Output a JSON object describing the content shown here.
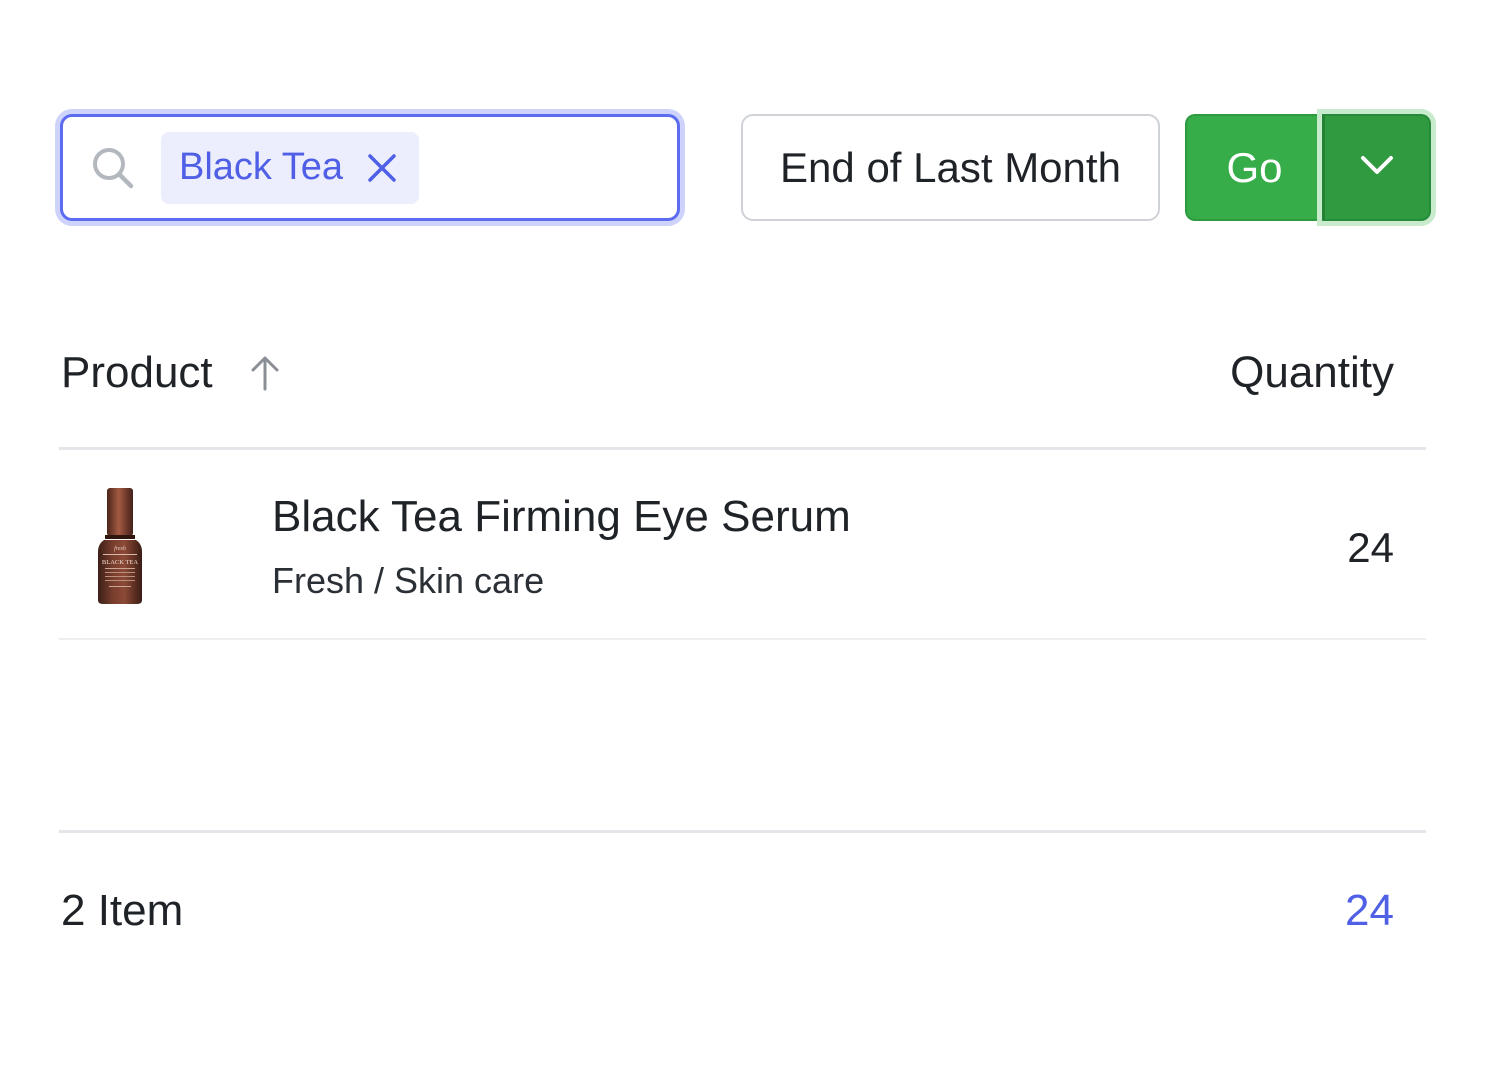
{
  "filter": {
    "chip_label": "Black Tea",
    "date_range": "End of Last Month",
    "go_label": "Go"
  },
  "table": {
    "columns": {
      "product": "Product",
      "quantity": "Quantity"
    },
    "sort": {
      "column": "product",
      "direction": "ascending"
    },
    "rows": [
      {
        "name": "Black Tea Firming Eye Serum",
        "category": "Fresh / Skin care",
        "quantity": "24"
      }
    ]
  },
  "footer": {
    "count_label": "2 Item",
    "total": "24"
  },
  "icons": {
    "search": "search-icon",
    "chip_close": "close-icon",
    "sort": "arrow-up-icon",
    "dropdown": "chevron-down-icon"
  },
  "colors": {
    "accent": "#5b6cf0",
    "chip_bg": "#eceefd",
    "go_green": "#37ad4a",
    "go_green_dark": "#2f9a3f",
    "total_blue": "#4f5fe6"
  }
}
